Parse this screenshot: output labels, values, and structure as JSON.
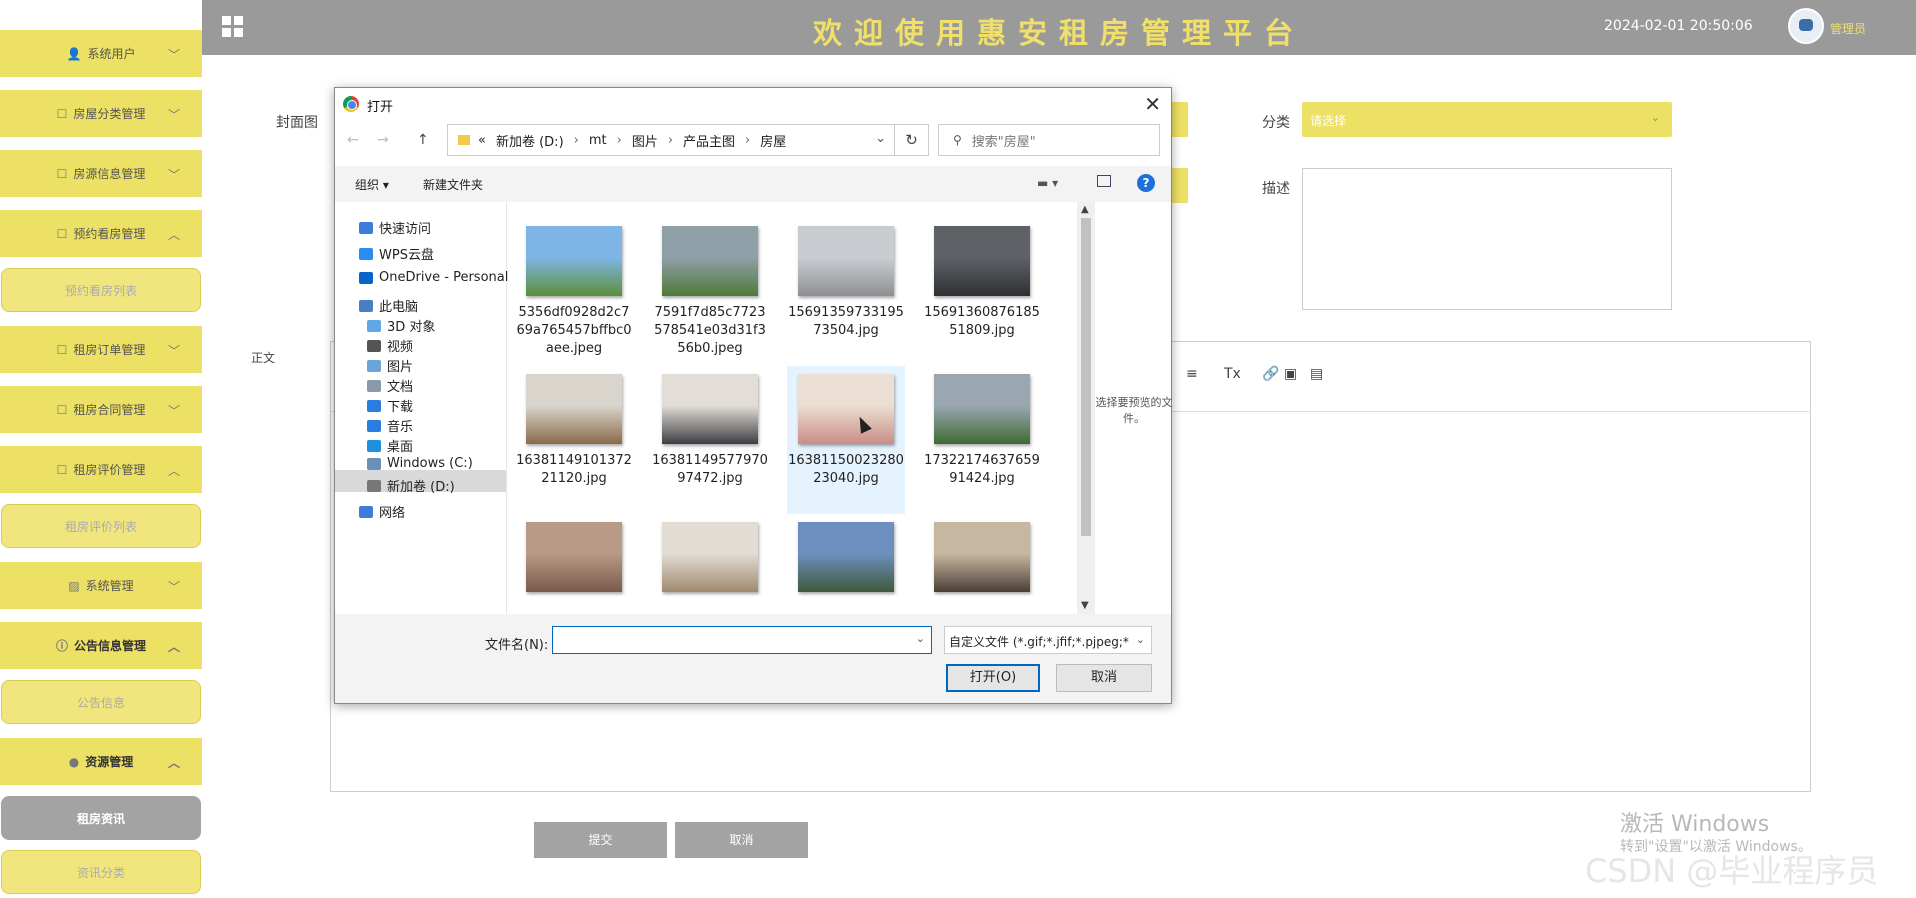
{
  "header": {
    "title": "欢迎使用惠安租房管理平台",
    "datetime": "2024-02-01 20:50:06",
    "username": "管理员"
  },
  "sidebar": {
    "items": [
      {
        "label": "系统用户",
        "icon": "user-icon",
        "expanded": false
      },
      {
        "label": "房屋分类管理",
        "icon": "doc-icon",
        "expanded": false
      },
      {
        "label": "房源信息管理",
        "icon": "doc-icon",
        "expanded": false
      },
      {
        "label": "预约看房管理",
        "icon": "doc-icon",
        "expanded": true,
        "sub": [
          "预约看房列表"
        ]
      },
      {
        "label": "租房订单管理",
        "icon": "doc-icon",
        "expanded": false
      },
      {
        "label": "租房合同管理",
        "icon": "doc-icon",
        "expanded": false
      },
      {
        "label": "租房评价管理",
        "icon": "doc-icon",
        "expanded": true,
        "sub": [
          "租房评价列表"
        ]
      },
      {
        "label": "系统管理",
        "icon": "image-icon",
        "expanded": false
      },
      {
        "label": "公告信息管理",
        "icon": "info-icon",
        "expanded": true,
        "sub": [
          "公告信息"
        ]
      },
      {
        "label": "资源管理",
        "icon": "pin-icon",
        "expanded": true,
        "sub": [
          "租房资讯",
          "资讯分类"
        ]
      }
    ]
  },
  "form": {
    "cover_label": "封面图",
    "category_label": "分类",
    "category_placeholder": "请选择",
    "desc_label": "描述",
    "body_label": "正文",
    "submit_label": "提交",
    "cancel_label": "取消"
  },
  "dialog": {
    "title": "打开",
    "path": [
      "«",
      "新加卷 (D:)",
      "mt",
      "图片",
      "产品主图",
      "房屋"
    ],
    "search_placeholder": "搜索\"房屋\"",
    "organize": "组织 ▾",
    "new_folder": "新建文件夹",
    "nav": [
      {
        "label": "快速访问",
        "icon": "star-icon",
        "color": "#3b7dd8"
      },
      {
        "label": "WPS云盘",
        "icon": "cloud-icon",
        "color": "#2a8bf2"
      },
      {
        "label": "OneDrive - Personal",
        "icon": "cloud-icon",
        "color": "#0a64c8"
      },
      {
        "label": "此电脑",
        "icon": "computer-icon",
        "color": "#4a7ec4"
      },
      {
        "label": "3D 对象",
        "icon": "cube-icon",
        "color": "#5fa8e8"
      },
      {
        "label": "视频",
        "icon": "film-icon",
        "color": "#555555"
      },
      {
        "label": "图片",
        "icon": "picture-icon",
        "color": "#6aa4d8"
      },
      {
        "label": "文档",
        "icon": "document-icon",
        "color": "#8899aa"
      },
      {
        "label": "下载",
        "icon": "download-icon",
        "color": "#2a7de1"
      },
      {
        "label": "音乐",
        "icon": "music-icon",
        "color": "#2a7de1"
      },
      {
        "label": "桌面",
        "icon": "desktop-icon",
        "color": "#1e90e0"
      },
      {
        "label": "Windows (C:)",
        "icon": "drive-icon",
        "color": "#6a8fb8"
      },
      {
        "label": "新加卷 (D:)",
        "icon": "drive-icon",
        "color": "#777777"
      },
      {
        "label": "网络",
        "icon": "network-icon",
        "color": "#3b7dd8"
      }
    ],
    "files": [
      {
        "name": "5356df0928d2c769a765457bffbc0aee.jpeg",
        "colors": [
          "#7fb5e6",
          "#5d8f3a"
        ]
      },
      {
        "name": "7591f7d85c7723578541e03d31f356b0.jpeg",
        "colors": [
          "#8fa0a8",
          "#4f7a3a"
        ]
      },
      {
        "name": "1569135973319573504.jpg",
        "colors": [
          "#c9cdd2",
          "#8e8f92"
        ]
      },
      {
        "name": "1569136087618551809.jpg",
        "colors": [
          "#5e6266",
          "#2e2f33"
        ]
      },
      {
        "name": "1638114910137221120.jpg",
        "colors": [
          "#d9d4cc",
          "#8a6a4a"
        ]
      },
      {
        "name": "1638114957797097472.jpg",
        "colors": [
          "#e2ddd6",
          "#3e3f44"
        ]
      },
      {
        "name": "1638115002328023040.jpg",
        "colors": [
          "#eadfd2",
          "#c98d86"
        ]
      },
      {
        "name": "1732217463765991424.jpg",
        "colors": [
          "#9aa7b0",
          "#3e6a34"
        ]
      },
      {
        "name": "",
        "colors": [
          "#b89a86",
          "#7a5a4a"
        ]
      },
      {
        "name": "",
        "colors": [
          "#e2dcd3",
          "#a08a6e"
        ]
      },
      {
        "name": "",
        "colors": [
          "#6d8fc0",
          "#3e5a3a"
        ]
      },
      {
        "name": "",
        "colors": [
          "#c8b7a0",
          "#4a3e36"
        ]
      }
    ],
    "preview_message": "选择要预览的文件。",
    "filename_label": "文件名(N):",
    "filename_value": "",
    "filter": "自定义文件 (*.gif;*.jfif;*.pjpeg;*",
    "open_label": "打开(O)",
    "cancel_label": "取消"
  },
  "watermark": {
    "line1": "激活 Windows",
    "line2": "转到\"设置\"以激活 Windows。",
    "csdn": "CSDN @毕业程序员"
  },
  "colors": {
    "accent": "#ece065",
    "header": "#9a9a9a",
    "active": "#a3a3a3"
  }
}
